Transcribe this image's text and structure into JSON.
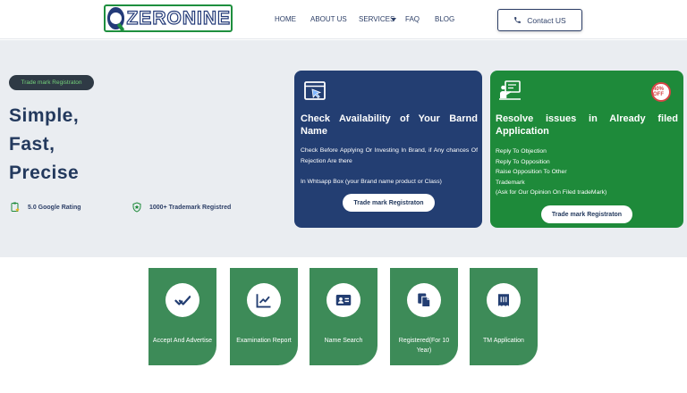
{
  "brand": {
    "name": "ZERONINE",
    "colors": {
      "navy": "#23395d",
      "green": "#1e8a3a",
      "service_green": "#3d8b58"
    }
  },
  "nav": {
    "home": "HOME",
    "about": "ABOUT US",
    "services": "SERVICES",
    "faq": "FAQ",
    "blog": "BLOG",
    "contact": "Contact US"
  },
  "hero": {
    "badge": "Trade mark Registraton",
    "headline": [
      "Simple,",
      "Fast,",
      "Precise"
    ],
    "stats": [
      {
        "icon": "clipboard-star-icon",
        "label": "5.0 Google Rating"
      },
      {
        "icon": "shield-star-icon",
        "label": "1000+ Trademark Registred"
      }
    ]
  },
  "cards": [
    {
      "icon": "window-cursor-icon",
      "title": "Check Availability of Your Barnd Name",
      "body": [
        "Check Before Applying Or Investing In Brand, if Any chances Of Rejection Are there",
        "",
        "In Whtsapp Box (your Brand name product or Class)"
      ],
      "button": "Trade mark Registraton"
    },
    {
      "icon": "presenter-board-icon",
      "badge": "40% OFF",
      "title": "Resolve issues in Already filed Application",
      "body": [
        "Reply To Objection",
        "Reply To Opposition",
        "Raise Opposition To Other",
        "Trademark",
        "(Ask for Our Opinion On Filed tradeMark)"
      ],
      "button": "Trade mark Registraton"
    }
  ],
  "services": [
    {
      "icon": "double-check-icon",
      "label": "Accept And Advertise"
    },
    {
      "icon": "chart-line-icon",
      "label": "Examination Report"
    },
    {
      "icon": "id-card-icon",
      "label": "Name Search"
    },
    {
      "icon": "copy-documents-icon",
      "label": "Registered(For 10 Year)"
    },
    {
      "icon": "receipt-icon",
      "label": "TM Application"
    }
  ]
}
